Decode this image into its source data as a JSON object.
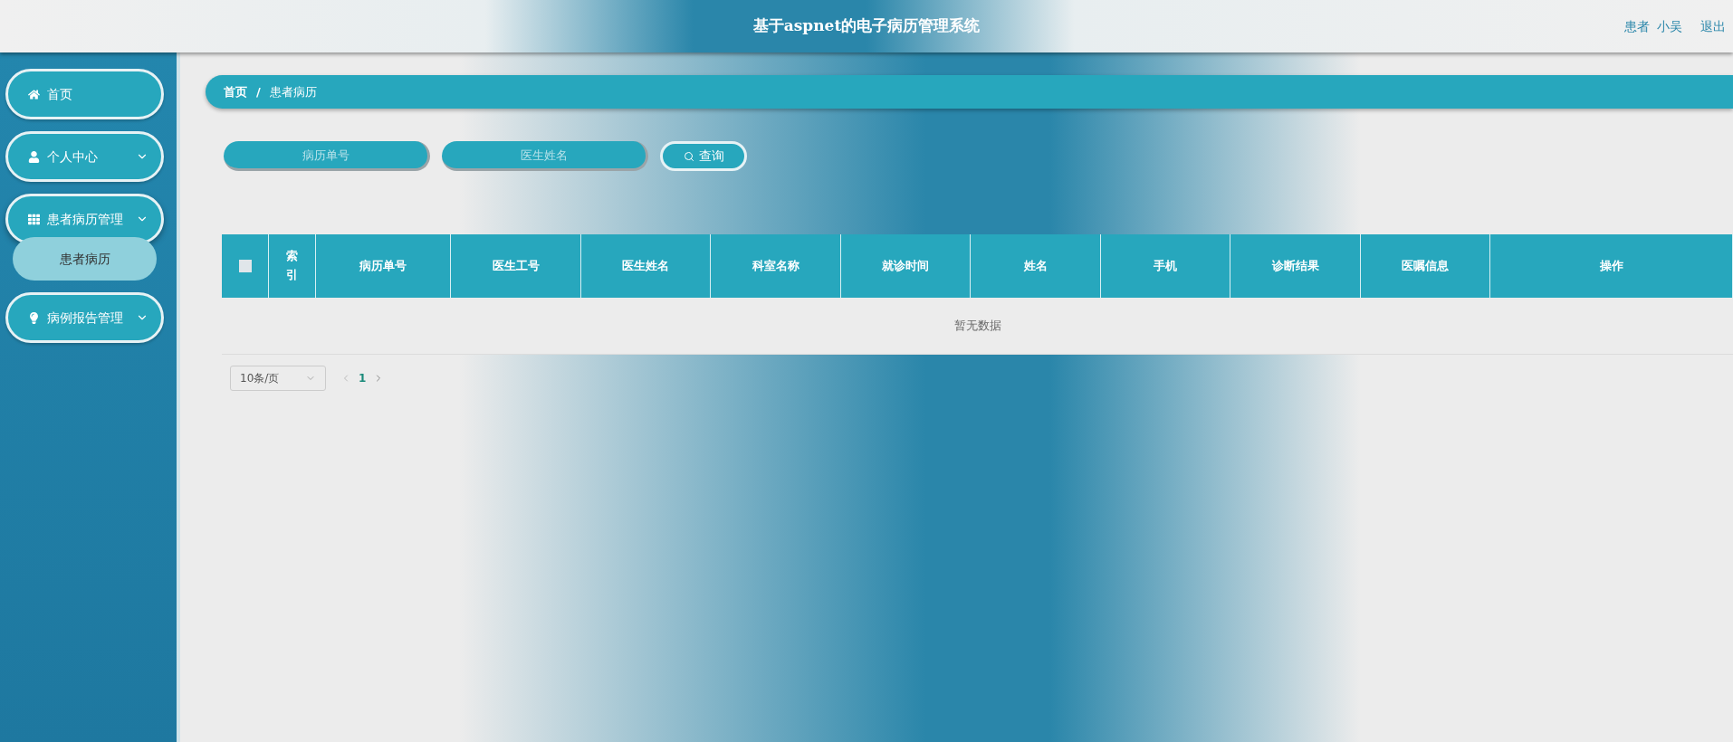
{
  "header": {
    "title": "基于aspnet的电子病历管理系统",
    "user_role": "患者",
    "user_name": "小吴",
    "logout": "退出"
  },
  "sidebar": {
    "items": [
      {
        "label": "首页",
        "expandable": false,
        "expanded": false
      },
      {
        "label": "个人中心",
        "expandable": true,
        "expanded": false
      },
      {
        "label": "患者病历管理",
        "expandable": true,
        "expanded": true,
        "children": [
          {
            "label": "患者病历",
            "selected": true
          }
        ]
      },
      {
        "label": "病例报告管理",
        "expandable": true,
        "expanded": false
      }
    ]
  },
  "breadcrumb": {
    "items": [
      "首页",
      "患者病历"
    ],
    "separator": "/"
  },
  "search": {
    "fields": [
      {
        "placeholder": "病历单号"
      },
      {
        "placeholder": "医生姓名"
      }
    ],
    "button": "查询"
  },
  "table": {
    "select_all_checked": false,
    "columns": [
      "索引",
      "病历单号",
      "医生工号",
      "医生姓名",
      "科室名称",
      "就诊时间",
      "姓名",
      "手机",
      "诊断结果",
      "医嘱信息",
      "操作"
    ],
    "empty_text": "暂无数据"
  },
  "pagination": {
    "page_size": "10条/页",
    "pages": [
      {
        "label": "1",
        "selected": true
      }
    ]
  }
}
